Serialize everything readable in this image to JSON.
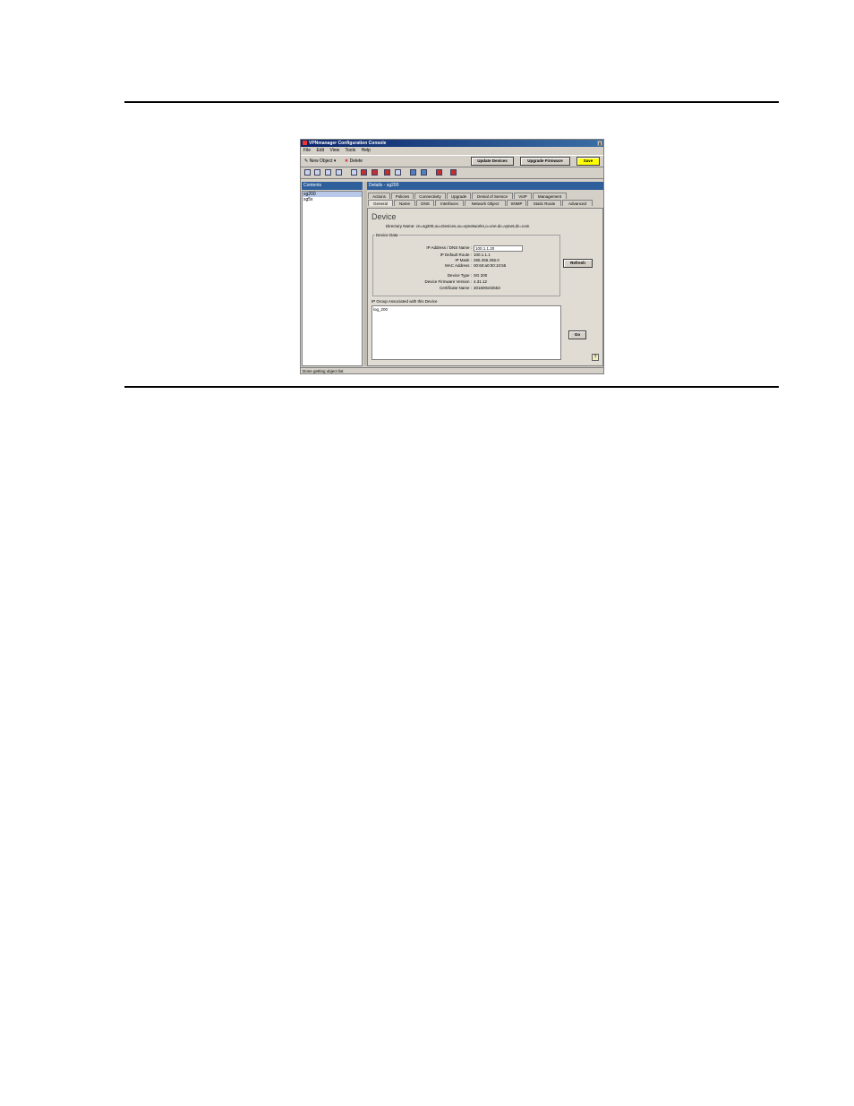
{
  "window": {
    "title": "VPNmanager Configuration Console",
    "close_label": "x"
  },
  "menu": [
    "File",
    "Edit",
    "View",
    "Tools",
    "Help"
  ],
  "toolbar": {
    "new_object": "New Object",
    "delete": "Delete",
    "update_devices": "Update Devices",
    "upgrade_firmware": "Upgrade Firmware",
    "save": "Save",
    "save_color": "#ffff00"
  },
  "left_pane": {
    "header": "Contents",
    "items": [
      "sg200",
      "sg5x"
    ]
  },
  "right_pane": {
    "header": "Details - sg200",
    "tabs_row1": [
      "Actions",
      "Policies",
      "Connectivity",
      "Upgrade",
      "Denial of Service",
      "VoIP",
      "Management"
    ],
    "tabs_row2": [
      "General",
      "Name",
      "DNS",
      "Interfaces",
      "Network Object",
      "SNMP",
      "Static Route",
      "Advanced"
    ],
    "active_tab": "General",
    "title": "Device",
    "directory_name": "Directory Name: cn=sg200,ou=Devices,ou=vpnetworks,o=vne.dc=vpnet,dc=com",
    "group_title": "Device Data",
    "fields": [
      {
        "label": "IP Address / DNS Name :",
        "value": "100.1.1.20"
      },
      {
        "label": "IP Default Route :",
        "value": "100.1.1.1"
      },
      {
        "label": "IP Mask :",
        "value": "255.255.255.0"
      },
      {
        "label": "MAC Address :",
        "value": "00:60:a0:00:10:55"
      },
      {
        "label": "Device Type :",
        "value": "SG 200"
      },
      {
        "label": "Device Firmware Version :",
        "value": "4.31.12"
      },
      {
        "label": "Certificate Name :",
        "value": "301600x02553"
      }
    ],
    "refresh_label": "Refresh",
    "ip_groups_label": "IP Group Associated with this Device",
    "ip_groups": [
      "log_200"
    ],
    "go_label": "Go",
    "help_icon": "?"
  },
  "status": "Done getting object list"
}
